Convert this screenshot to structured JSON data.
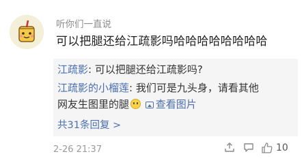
{
  "comment": {
    "username": "听你们一直说",
    "text": "可以把腿还给江疏影吗哈哈哈哈哈哈哈哈",
    "timestamp": "2-26 21:37",
    "like_count": "10"
  },
  "replies": {
    "reply1": {
      "nick": "江疏影",
      "text": ": 可以把腿还给江疏影吗?"
    },
    "reply2": {
      "nick": "江疏影的小榴莲",
      "text_line1": ": 我们可是九头身，请看其他",
      "text_line2": "网友生图里的腿",
      "image_link": "查看图片"
    },
    "total_label": "共31条回复 >"
  },
  "icons": {
    "avatar": "cartoon-avatar",
    "share": "share-icon",
    "comment": "comment-icon",
    "like": "thumbs-up-icon",
    "emoji": "smile-emoji-icon",
    "image": "image-icon"
  },
  "colors": {
    "link": "#4a6fb1",
    "quote_bg": "#f5f5f5",
    "muted": "#8a8a8a"
  }
}
